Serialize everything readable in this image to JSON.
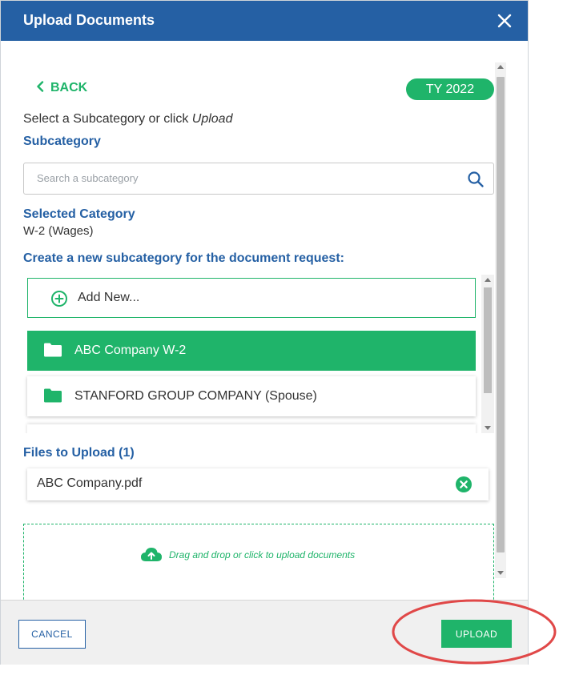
{
  "header": {
    "title": "Upload Documents"
  },
  "nav": {
    "back_label": "BACK",
    "tax_year": "TY 2022"
  },
  "instruction": {
    "prefix": "Select a Subcategory or click ",
    "emphasis": "Upload"
  },
  "subcategory": {
    "label": "Subcategory",
    "search_placeholder": "Search a subcategory"
  },
  "selected_category": {
    "label": "Selected Category",
    "value": "W-2 (Wages)"
  },
  "create_label": "Create a new subcategory for the document request:",
  "list": {
    "add_new": "Add New...",
    "items": [
      {
        "label": "ABC Company W-2",
        "selected": true
      },
      {
        "label": "STANFORD GROUP COMPANY (Spouse)",
        "selected": false
      }
    ]
  },
  "files": {
    "label": "Files to Upload (1)",
    "items": [
      {
        "name": "ABC Company.pdf"
      }
    ]
  },
  "dropzone": {
    "text": "Drag and drop or click to upload documents"
  },
  "footer": {
    "cancel_label": "CANCEL",
    "upload_label": "UPLOAD"
  },
  "colors": {
    "header": "#2560a4",
    "accent": "#1fb46a",
    "annotation": "#e04848"
  }
}
